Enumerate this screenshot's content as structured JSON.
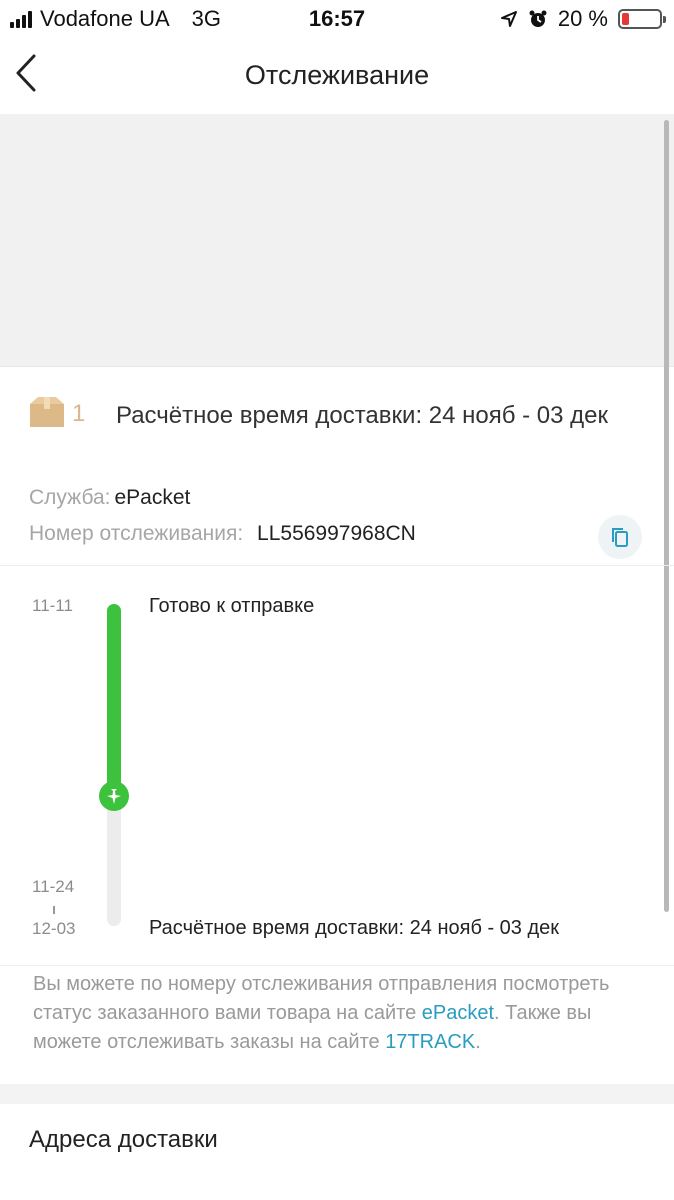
{
  "status_bar": {
    "carrier": "Vodafone UA",
    "network": "3G",
    "time": "16:57",
    "battery_text": "20 %",
    "battery_level": 0.2,
    "battery_color": "#e53935"
  },
  "header": {
    "title": "Отслеживание",
    "back_icon": "chevron-left-icon"
  },
  "package": {
    "icon": "package-box-icon",
    "count": "1",
    "eta_text": "Расчётное время доставки: 24 нояб - 03 дек",
    "service_label": "Служба:",
    "service_value": "ePacket",
    "tracking_label": "Номер отслеживания:",
    "tracking_number": "LL556997968CN",
    "copy_icon": "copy-icon"
  },
  "timeline": {
    "accent_color": "#3cc23c",
    "progress_icon": "airplane-icon",
    "events": [
      {
        "date": "11-11",
        "text": "Готово к отправке"
      },
      {
        "date": "11-24",
        "text": ""
      },
      {
        "date": "12-03",
        "text": "Расчётное время доставки: 24 нояб - 03 дек"
      }
    ]
  },
  "notice": {
    "part1": "Вы можете по номеру отслеживания отправления посмотреть статус заказанного вами товара на сайте ",
    "link1": "ePacket",
    "part2": ". Также вы можете отслеживать заказы на сайте ",
    "link2": "17TRACK",
    "part3": ".",
    "link_color": "#2a9cc0"
  },
  "addresses": {
    "title": "Адреса доставки"
  }
}
